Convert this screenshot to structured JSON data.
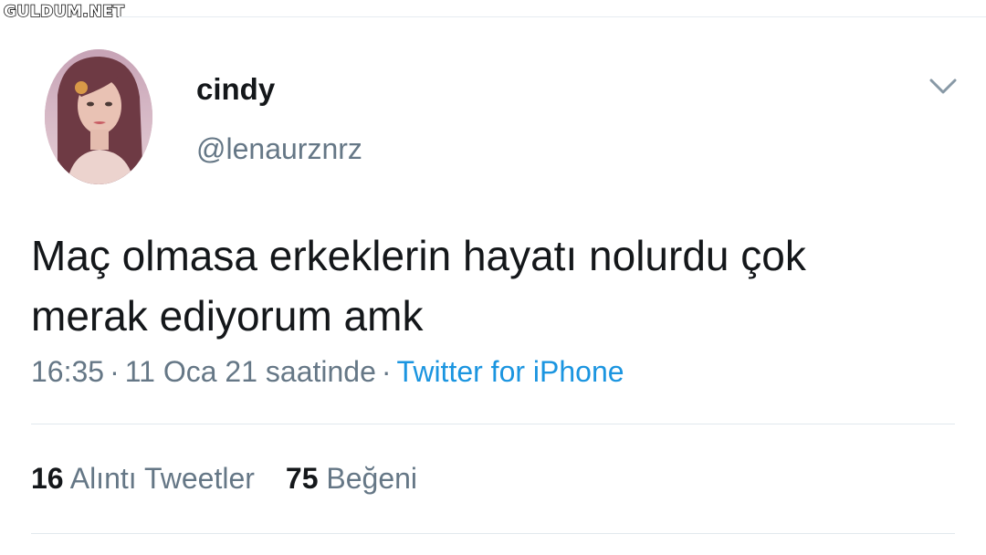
{
  "watermark": {
    "text": "GULDUM.NET"
  },
  "tweet": {
    "display_name": "cindy",
    "handle": "@lenaurznrz",
    "text_line_1": "Maç olmasa erkeklerin hayatı nolurdu çok",
    "text_line_2": "merak ediyorum amk",
    "time": "16:35",
    "separator": "·",
    "date": "11 Oca 21 saatinde",
    "source": "Twitter for iPhone"
  },
  "stats": {
    "quotes_count": "16",
    "quotes_label": "Alıntı Tweetler",
    "likes_count": "75",
    "likes_label": "Beğeni"
  },
  "icons": {
    "menu": "chevron-down-icon",
    "avatar": "profile-photo"
  },
  "colors": {
    "text": "#14171a",
    "secondary": "#657786",
    "link": "#1b95e0",
    "divider": "#e1e8ed"
  }
}
